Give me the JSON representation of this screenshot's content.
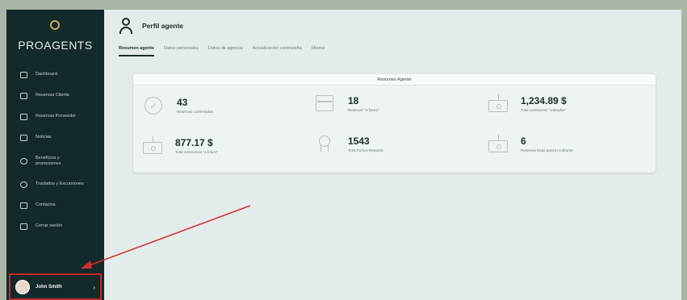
{
  "app": {
    "logo_text": "PROAGENTS",
    "accent_color": "#c9a86a",
    "sidebar_color": "#132a2a",
    "highlight_color": "#c62828"
  },
  "sidebar": {
    "items": [
      {
        "label": "Dashboard",
        "icon": "monitor-icon"
      },
      {
        "label": "Reservas Cliente",
        "icon": "calendar-icon"
      },
      {
        "label": "Reservas Proveedor",
        "icon": "calendar-icon"
      },
      {
        "label": "Noticias",
        "icon": "news-icon"
      },
      {
        "label": "Beneficios y promociones",
        "icon": "gift-icon"
      },
      {
        "label": "Traslados y Excursiones",
        "icon": "car-icon"
      },
      {
        "label": "Contactos",
        "icon": "contacts-icon"
      },
      {
        "label": "Cerrar sesión",
        "icon": "logout-icon"
      }
    ],
    "user": {
      "name": "John Smith"
    }
  },
  "header": {
    "title": "Perfil agente",
    "tabs": [
      {
        "label": "Resumen agente",
        "active": true
      },
      {
        "label": "Datos personales",
        "active": false
      },
      {
        "label": "Datos de agencia",
        "active": false
      },
      {
        "label": "Actualización contraseña",
        "active": false
      },
      {
        "label": "Idioma",
        "active": false
      }
    ]
  },
  "summary": {
    "title": "Resumen Agente",
    "stats": [
      {
        "value": "43",
        "label": "Reservas confirmadas",
        "icon": "check-circle-icon"
      },
      {
        "value": "18",
        "label": "Reservas \"a futuro\"",
        "icon": "calendar-icon"
      },
      {
        "value": "1,234.89 $",
        "label": "Total comisiones \"cobradas\"",
        "icon": "cash-icon"
      },
      {
        "value": "877.17 $",
        "label": "Total comisiones \"a futuro\"",
        "icon": "cash-icon"
      },
      {
        "value": "1543",
        "label": "Total Puntos Rewards",
        "icon": "award-icon"
      },
      {
        "value": "6",
        "label": "Reservas listas para tu cobrar/te",
        "icon": "cash-icon"
      }
    ]
  }
}
